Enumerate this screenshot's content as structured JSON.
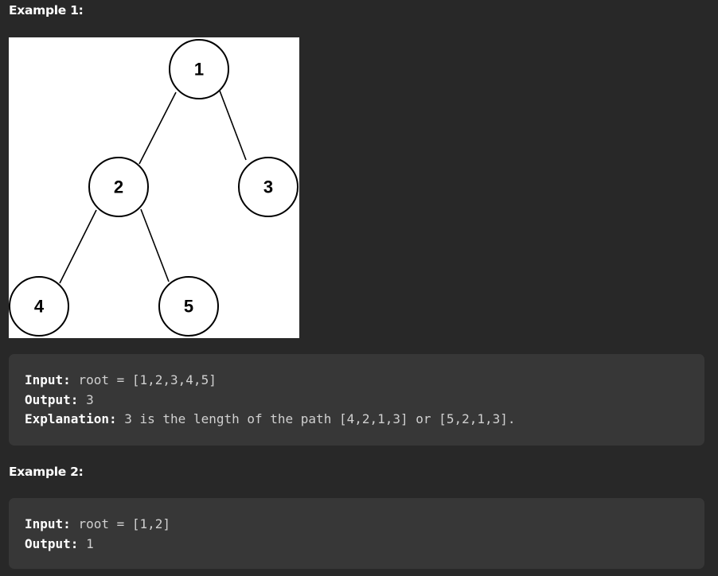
{
  "example1": {
    "heading": "Example 1:",
    "tree": {
      "nodes": [
        "1",
        "2",
        "3",
        "4",
        "5"
      ]
    },
    "input_label": "Input:",
    "input_value": "root = [1,2,3,4,5]",
    "output_label": "Output:",
    "output_value": "3",
    "explanation_label": "Explanation:",
    "explanation_value": "3 is the length of the path [4,2,1,3] or [5,2,1,3]."
  },
  "example2": {
    "heading": "Example 2:",
    "input_label": "Input:",
    "input_value": "root = [1,2]",
    "output_label": "Output:",
    "output_value": "1"
  }
}
